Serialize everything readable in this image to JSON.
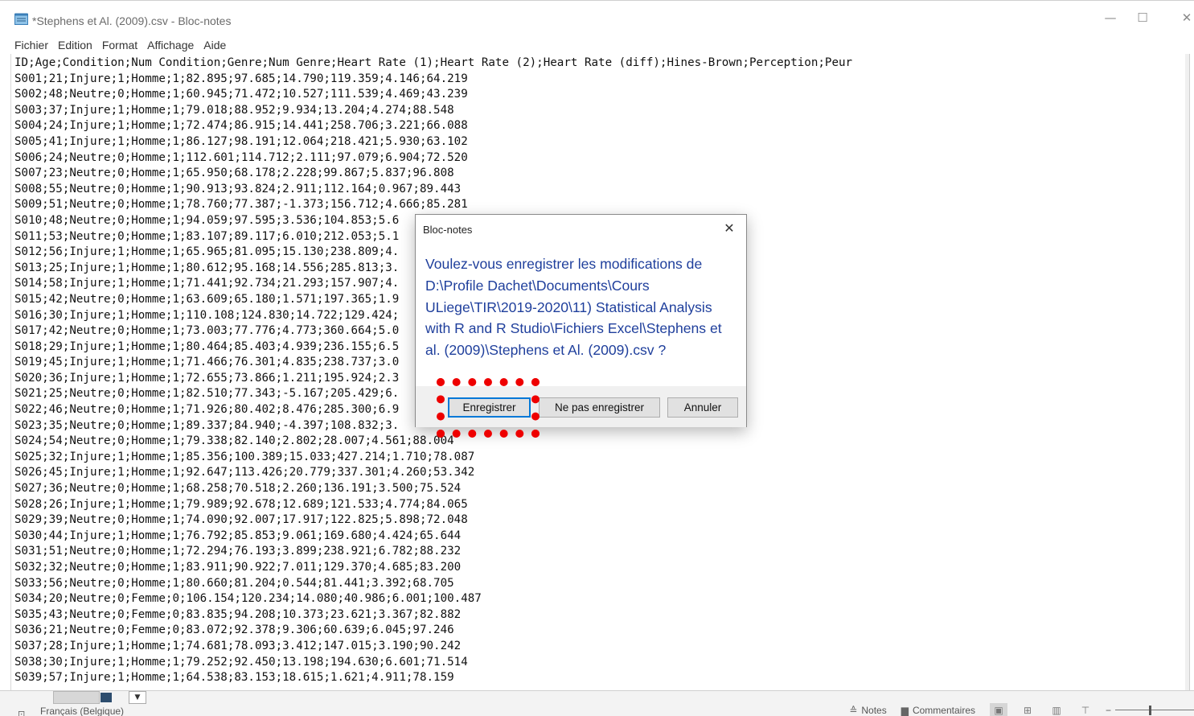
{
  "window": {
    "title": "*Stephens et Al. (2009).csv - Bloc-notes",
    "min_glyph": "—",
    "max_glyph": "☐",
    "close_glyph": "✕"
  },
  "menu": [
    "Fichier",
    "Edition",
    "Format",
    "Affichage",
    "Aide"
  ],
  "editor": {
    "lines": [
      "ID;Age;Condition;Num Condition;Genre;Num Genre;Heart Rate (1);Heart Rate (2);Heart Rate (diff);Hines-Brown;Perception;Peur",
      "S001;21;Injure;1;Homme;1;82.895;97.685;14.790;119.359;4.146;64.219",
      "S002;48;Neutre;0;Homme;1;60.945;71.472;10.527;111.539;4.469;43.239",
      "S003;37;Injure;1;Homme;1;79.018;88.952;9.934;13.204;4.274;88.548",
      "S004;24;Injure;1;Homme;1;72.474;86.915;14.441;258.706;3.221;66.088",
      "S005;41;Injure;1;Homme;1;86.127;98.191;12.064;218.421;5.930;63.102",
      "S006;24;Neutre;0;Homme;1;112.601;114.712;2.111;97.079;6.904;72.520",
      "S007;23;Neutre;0;Homme;1;65.950;68.178;2.228;99.867;5.837;96.808",
      "S008;55;Neutre;0;Homme;1;90.913;93.824;2.911;112.164;0.967;89.443",
      "S009;51;Neutre;0;Homme;1;78.760;77.387;-1.373;156.712;4.666;85.281",
      "S010;48;Neutre;0;Homme;1;94.059;97.595;3.536;104.853;5.6",
      "S011;53;Neutre;0;Homme;1;83.107;89.117;6.010;212.053;5.1",
      "S012;56;Injure;1;Homme;1;65.965;81.095;15.130;238.809;4.",
      "S013;25;Injure;1;Homme;1;80.612;95.168;14.556;285.813;3.",
      "S014;58;Injure;1;Homme;1;71.441;92.734;21.293;157.907;4.",
      "S015;42;Neutre;0;Homme;1;63.609;65.180;1.571;197.365;1.9",
      "S016;30;Injure;1;Homme;1;110.108;124.830;14.722;129.424;",
      "S017;42;Neutre;0;Homme;1;73.003;77.776;4.773;360.664;5.0",
      "S018;29;Injure;1;Homme;1;80.464;85.403;4.939;236.155;6.5",
      "S019;45;Injure;1;Homme;1;71.466;76.301;4.835;238.737;3.0",
      "S020;36;Injure;1;Homme;1;72.655;73.866;1.211;195.924;2.3",
      "S021;25;Neutre;0;Homme;1;82.510;77.343;-5.167;205.429;6.",
      "S022;46;Neutre;0;Homme;1;71.926;80.402;8.476;285.300;6.9",
      "S023;35;Neutre;0;Homme;1;89.337;84.940;-4.397;108.832;3.",
      "S024;54;Neutre;0;Homme;1;79.338;82.140;2.802;28.007;4.561;88.004",
      "S025;32;Injure;1;Homme;1;85.356;100.389;15.033;427.214;1.710;78.087",
      "S026;45;Injure;1;Homme;1;92.647;113.426;20.779;337.301;4.260;53.342",
      "S027;36;Neutre;0;Homme;1;68.258;70.518;2.260;136.191;3.500;75.524",
      "S028;26;Injure;1;Homme;1;79.989;92.678;12.689;121.533;4.774;84.065",
      "S029;39;Neutre;0;Homme;1;74.090;92.007;17.917;122.825;5.898;72.048",
      "S030;44;Injure;1;Homme;1;76.792;85.853;9.061;169.680;4.424;65.644",
      "S031;51;Neutre;0;Homme;1;72.294;76.193;3.899;238.921;6.782;88.232",
      "S032;32;Neutre;0;Homme;1;83.911;90.922;7.011;129.370;4.685;83.200",
      "S033;56;Neutre;0;Homme;1;80.660;81.204;0.544;81.441;3.392;68.705",
      "S034;20;Neutre;0;Femme;0;106.154;120.234;14.080;40.986;6.001;100.487",
      "S035;43;Neutre;0;Femme;0;83.835;94.208;10.373;23.621;3.367;82.882",
      "S036;21;Neutre;0;Femme;0;83.072;92.378;9.306;60.639;6.045;97.246",
      "S037;28;Injure;1;Homme;1;74.681;78.093;3.412;147.015;3.190;90.242",
      "S038;30;Injure;1;Homme;1;79.252;92.450;13.198;194.630;6.601;71.514",
      "S039;57;Injure;1;Homme;1;64.538;83.153;18.615;1.621;4.911;78.159"
    ]
  },
  "dialog": {
    "title": "Bloc-notes",
    "message": "Voulez-vous enregistrer les modifications de D:\\Profile Dachet\\Documents\\Cours ULiege\\TIR\\2019-2020\\11) Statistical Analysis with R and R Studio\\Fichiers Excel\\Stephens et al. (2009)\\Stephens et Al. (2009).csv ?",
    "close_glyph": "✕",
    "buttons": {
      "save": "Enregistrer",
      "dont_save": "Ne pas enregistrer",
      "cancel": "Annuler"
    },
    "highlight_color": "#ee0000"
  },
  "statusbar": {
    "language": "Français (Belgique)",
    "notes": "Notes",
    "comments": "Commentaires",
    "dropdown_glyph": "▼"
  }
}
